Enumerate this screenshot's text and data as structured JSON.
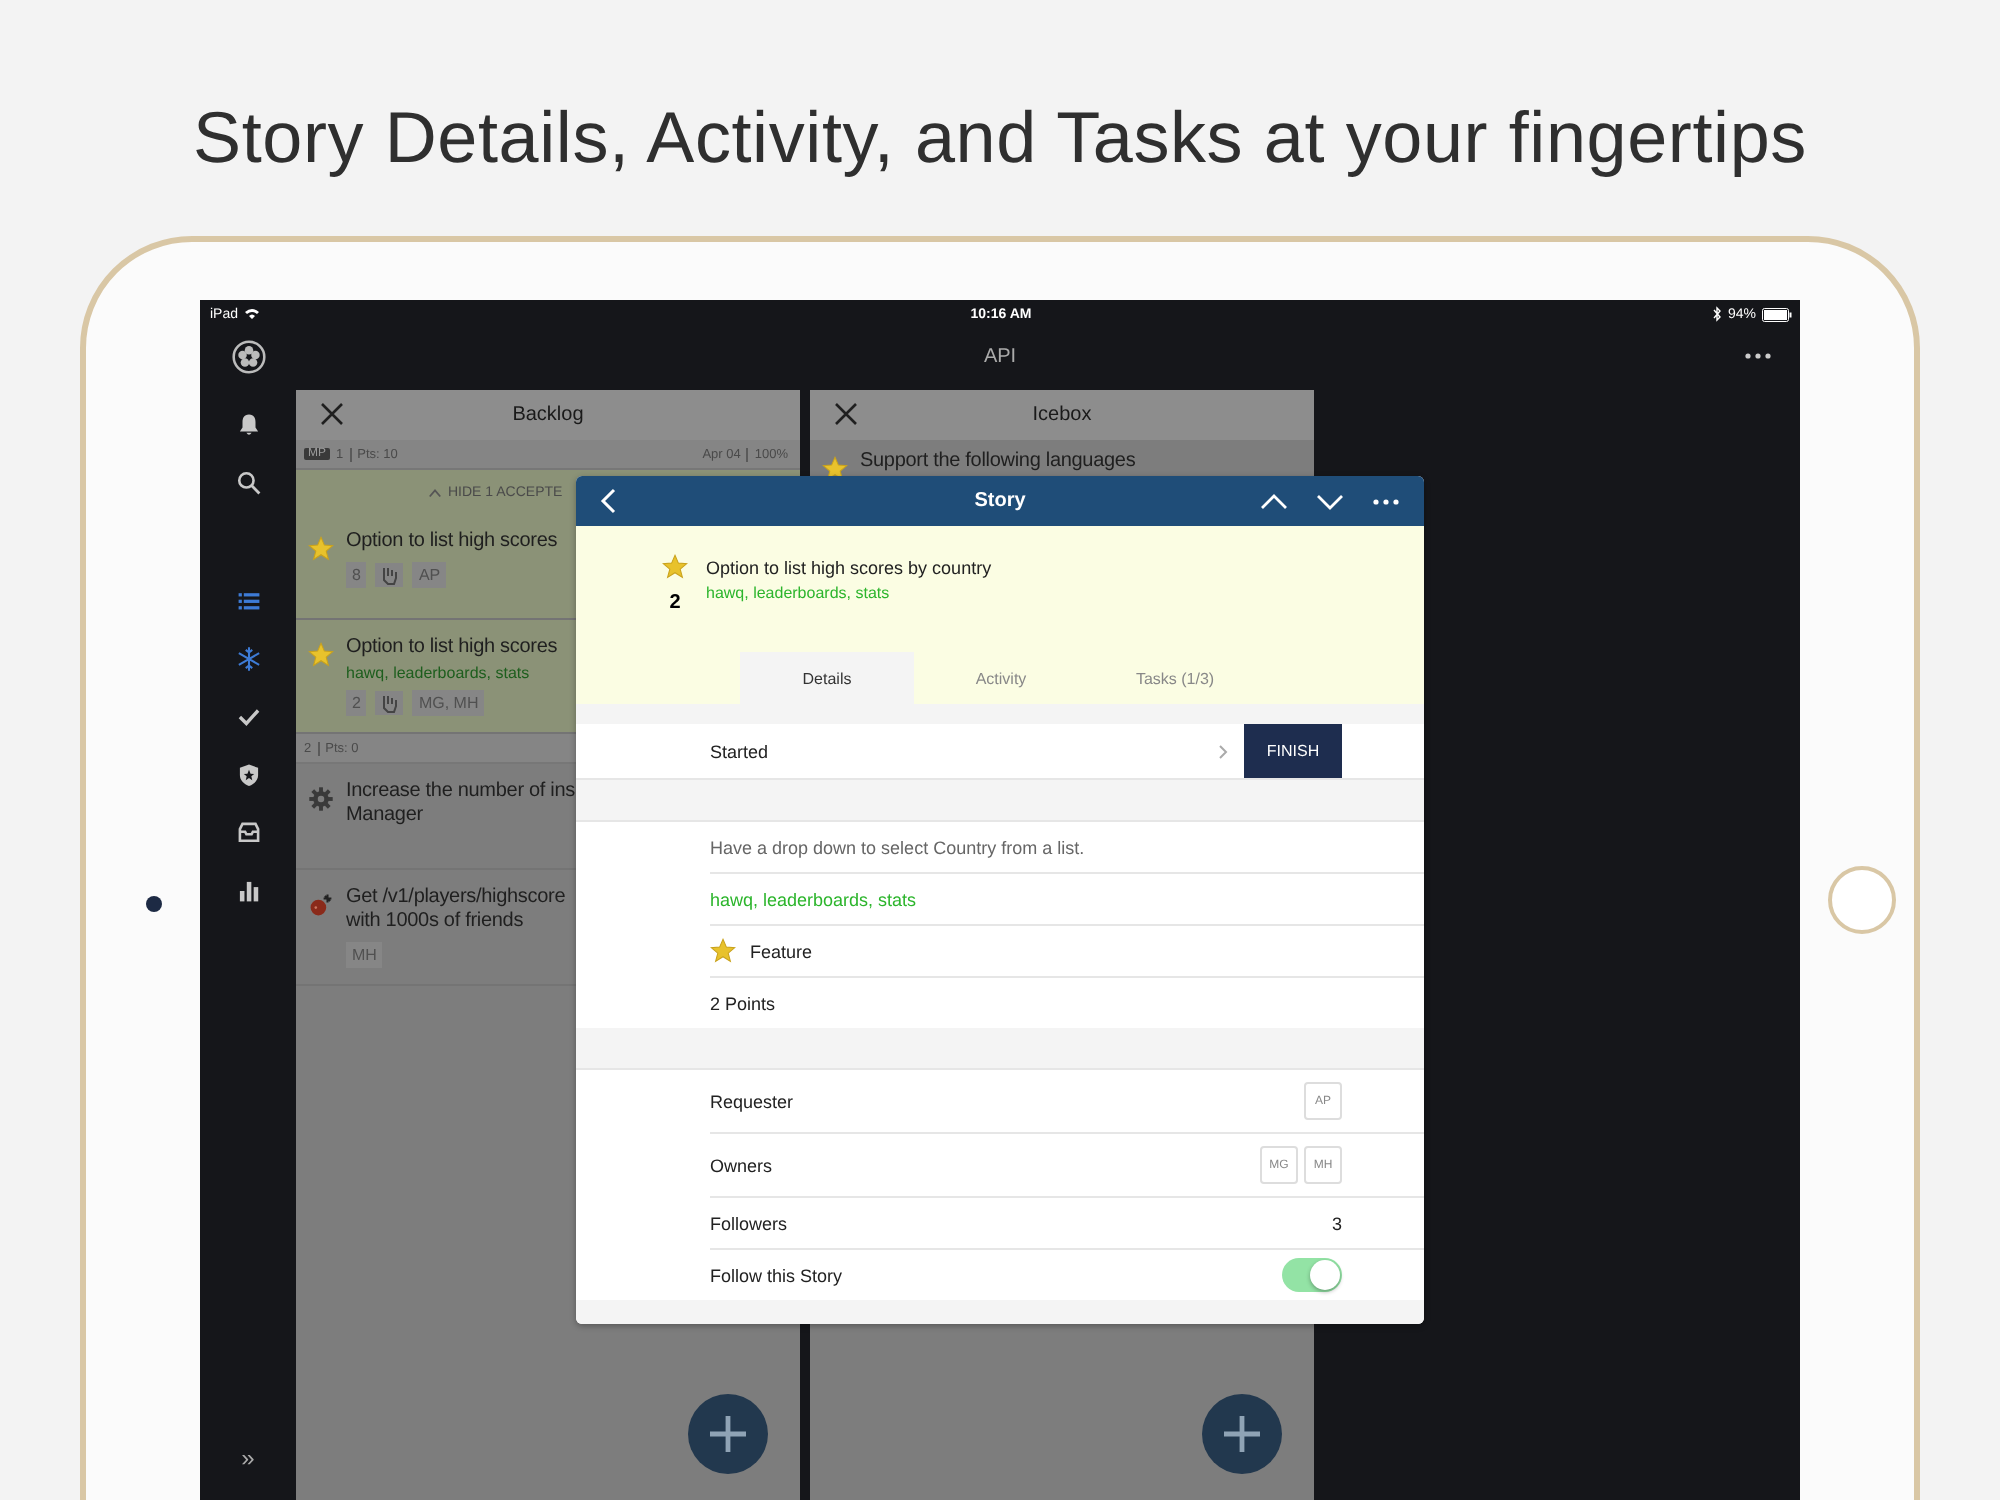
{
  "headline": "Story Details, Activity, and Tasks at your fingertips",
  "status_bar": {
    "device": "iPad",
    "time": "10:16 AM",
    "battery": "94%"
  },
  "top_bar": {
    "title": "API"
  },
  "sidebar": {
    "items": [
      {
        "selected": false
      },
      {
        "selected": false
      },
      {
        "selected": true
      },
      {
        "selected": true
      },
      {
        "selected": false
      },
      {
        "selected": false
      },
      {
        "selected": false
      },
      {
        "selected": false
      }
    ],
    "expand": "»"
  },
  "columns": [
    {
      "title": "Backlog",
      "summary": {
        "badge": "MP",
        "count": "1",
        "points": "Pts: 10",
        "date": "Apr 04",
        "percent": "100%"
      },
      "toggle": "HIDE 1 ACCEPTE",
      "groups": [
        {
          "stories": [
            {
              "kind": "feature",
              "accepted": true,
              "title": "Option to list high scores",
              "estimate": "8",
              "owners": "AP"
            },
            {
              "kind": "feature",
              "accepted": true,
              "title": "Option to list high scores",
              "labels": "hawq, leaderboards, stats",
              "estimate": "2",
              "owners": "MG, MH"
            }
          ]
        },
        {
          "header": {
            "count": "2",
            "points": "Pts: 0"
          },
          "stories": [
            {
              "kind": "chore",
              "accepted": false,
              "title": "Increase the number of ins\nManager"
            },
            {
              "kind": "bug",
              "accepted": false,
              "title": "Get /v1/players/highscore\nwith 1000s of friends",
              "owners": "MH"
            }
          ]
        }
      ]
    },
    {
      "title": "Icebox",
      "groups": [
        {
          "stories": [
            {
              "kind": "feature",
              "title": "Support the following languages"
            }
          ]
        }
      ]
    }
  ],
  "modal": {
    "title": "Story",
    "story": {
      "kind": "feature",
      "name": "Option to list high scores by country",
      "labels": "hawq, leaderboards, stats",
      "estimate": "2"
    },
    "tabs": [
      {
        "label": "Details",
        "selected": true
      },
      {
        "label": "Activity",
        "selected": false
      },
      {
        "label": "Tasks (1/3)",
        "selected": false
      }
    ],
    "state": {
      "label": "Started",
      "button": "FINISH"
    },
    "details": [
      {
        "kind": "description",
        "text": "Have a drop down to select Country from a list."
      },
      {
        "kind": "labels",
        "text": "hawq, leaderboards, stats"
      },
      {
        "kind": "type",
        "text": "Feature"
      },
      {
        "kind": "points",
        "text": "2 Points"
      }
    ],
    "people": [
      {
        "kind": "avatars",
        "label": "Requester",
        "initials": [
          "AP"
        ]
      },
      {
        "kind": "avatars",
        "label": "Owners",
        "initials": [
          "MG",
          "MH"
        ]
      },
      {
        "kind": "count",
        "label": "Followers",
        "value": "3"
      },
      {
        "kind": "toggle",
        "label": "Follow this Story",
        "on": true
      }
    ]
  }
}
